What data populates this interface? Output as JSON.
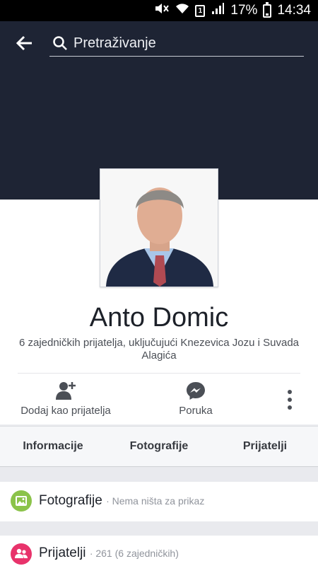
{
  "status_bar": {
    "battery": "17%",
    "time": "14:34",
    "sim": "1"
  },
  "header": {
    "back_icon": "arrow-left-icon",
    "search_icon": "search-icon",
    "search_placeholder": "Pretraživanje"
  },
  "profile": {
    "name": "Anto Domic",
    "mutual_friends": "6 zajedničkih prijatelja, uključujući Knezevica Jozu i Suvada Alagića"
  },
  "actions": {
    "add_friend": "Dodaj kao prijatelja",
    "message": "Poruka"
  },
  "tabs": [
    "Informacije",
    "Fotografije",
    "Prijatelji"
  ],
  "sections": {
    "photos": {
      "title": "Fotografije",
      "subtitle": "· Nema ništa za prikaz"
    },
    "friends": {
      "title": "Prijatelji",
      "subtitle": "· 261 (6 zajedničkih)"
    }
  },
  "colors": {
    "cover": "#1e2434",
    "photos_icon": "#8bc34a",
    "friends_icon": "#e8336b"
  }
}
